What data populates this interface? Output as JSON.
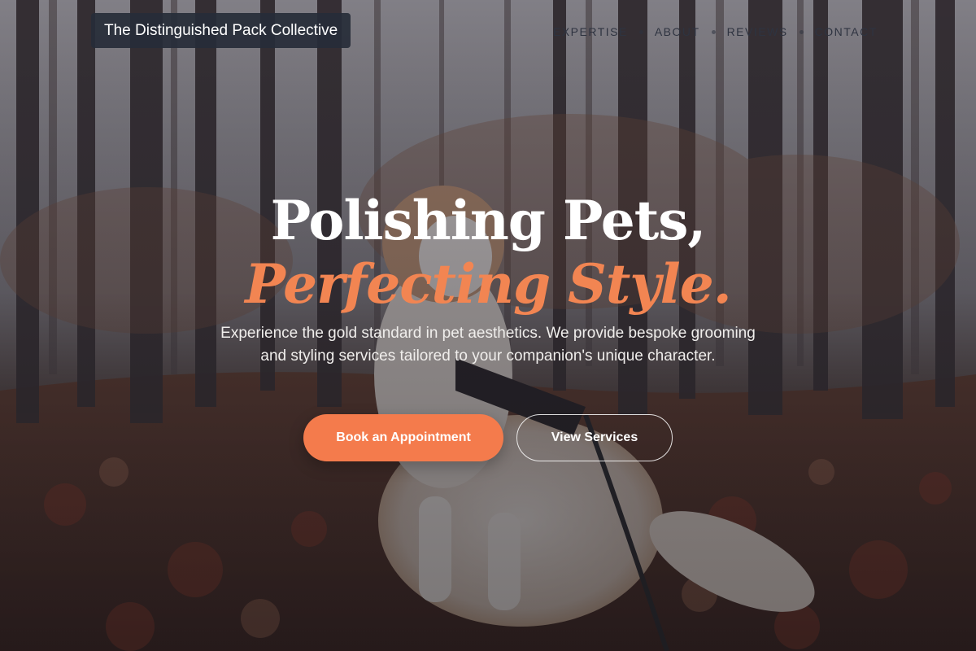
{
  "brand": {
    "name": "The Distinguished Pack Collective"
  },
  "nav": {
    "items": [
      {
        "label": "Expertise"
      },
      {
        "label": "About"
      },
      {
        "label": "Reviews"
      },
      {
        "label": "Contact"
      }
    ]
  },
  "hero": {
    "title_line1": "Polishing Pets,",
    "title_line2": "Perfecting Style.",
    "subtitle": "Experience the gold standard in pet aesthetics. We provide bespoke grooming and styling services tailored to your companion's unique character.",
    "primary_cta": "Book an Appointment",
    "secondary_cta": "View Services"
  },
  "colors": {
    "accent": "#f47b4c",
    "accent_text": "#f28552",
    "logo_bg": "#262c38",
    "nav_text": "#2e3340"
  }
}
